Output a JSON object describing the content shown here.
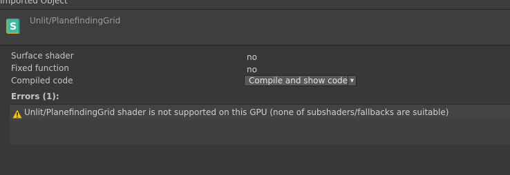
{
  "header": {
    "title": "Imported Object"
  },
  "asset": {
    "name": "Unlit/PlanefindingGrid",
    "icon": "shader-icon",
    "icon_letter": "S"
  },
  "properties": {
    "surface_shader": {
      "label": "Surface shader",
      "value": "no"
    },
    "fixed_function": {
      "label": "Fixed function",
      "value": "no"
    },
    "compiled_code": {
      "label": "Compiled code",
      "dropdown_value": "Compile and show code",
      "arrow": "▼"
    }
  },
  "errors": {
    "title": "Errors (1):",
    "items": [
      {
        "icon": "warning-icon",
        "message": "Unlit/PlanefindingGrid shader is not supported on this GPU (none of subshaders/fallbacks are suitable)"
      }
    ]
  },
  "colors": {
    "background": "#383838",
    "warning": "#f0c419",
    "shader_icon_bg": "#3fae9a"
  }
}
